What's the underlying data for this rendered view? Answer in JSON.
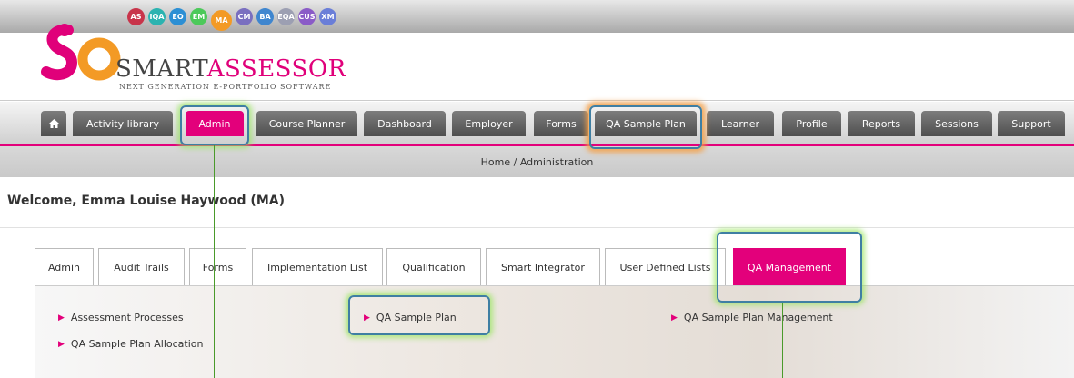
{
  "role_badges": [
    {
      "label": "AS",
      "color": "#c8344a"
    },
    {
      "label": "IQA",
      "color": "#2bb3b0"
    },
    {
      "label": "EO",
      "color": "#2c8fd4"
    },
    {
      "label": "EM",
      "color": "#4cc95a"
    },
    {
      "label": "MA",
      "color": "#f39a25"
    },
    {
      "label": "CM",
      "color": "#7a6fc0"
    },
    {
      "label": "BA",
      "color": "#3f86cf"
    },
    {
      "label": "EQA",
      "color": "#9c9fb2"
    },
    {
      "label": "CUS",
      "color": "#8a5bc7"
    },
    {
      "label": "XM",
      "color": "#6a7ed8"
    }
  ],
  "logo": {
    "brand_plain": "SMART",
    "brand_accent": "ASSESSOR",
    "tagline": "Next Generation E-Portfolio Software",
    "accent_color": "#e0007a"
  },
  "nav": {
    "home_icon": "home-icon",
    "items": [
      "Activity library",
      "Admin",
      "Course Planner",
      "Dashboard",
      "Employer",
      "Forms",
      "QA Sample Plan",
      "Learner",
      "Profile",
      "Reports",
      "Sessions",
      "Support"
    ],
    "active": "Admin"
  },
  "breadcrumb": "Home / Administration",
  "welcome": "Welcome, Emma Louise Haywood (MA)",
  "admin_tabs": {
    "items": [
      "Admin",
      "Audit Trails",
      "Forms",
      "Implementation List",
      "Qualification",
      "Smart Integrator",
      "User Defined Lists",
      "QA Management"
    ],
    "active": "QA Management"
  },
  "qa_links": [
    "Assessment Processes",
    "QA Sample Plan",
    "QA Sample Plan Management",
    "QA Sample Plan Allocation"
  ],
  "colors": {
    "brand_pink": "#e3007b",
    "highlight_border": "#3f7fa3"
  }
}
